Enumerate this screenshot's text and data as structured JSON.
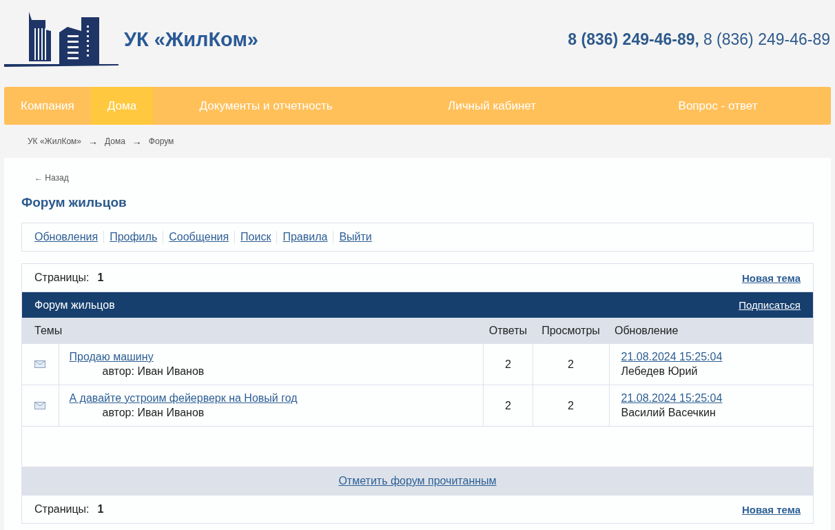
{
  "header": {
    "logo_text": "УК «ЖилКом»",
    "phone_primary": "8 (836) 249-46-89,",
    "phone_secondary": "8 (836) 249-46-89"
  },
  "nav": [
    {
      "label": "Компания",
      "selected": false
    },
    {
      "label": "Дома",
      "selected": true
    },
    {
      "label": "Документы и отчетность",
      "selected": false
    },
    {
      "label": "Личный кабинет",
      "selected": false
    },
    {
      "label": "Вопрос - ответ",
      "selected": false
    }
  ],
  "breadcrumbs": [
    {
      "kind": "link",
      "text": "УК «ЖилКом»"
    },
    {
      "kind": "arrow",
      "text": "→"
    },
    {
      "kind": "link",
      "text": "Дома"
    },
    {
      "kind": "arrow",
      "text": "→"
    },
    {
      "kind": "link",
      "text": "Форум"
    }
  ],
  "back_link": "← Назад",
  "page_title": "Форум жильцов",
  "forum_menu": [
    "Обновления",
    "Профиль",
    "Сообщения",
    "Поиск",
    "Правила",
    "Выйти"
  ],
  "pager_top": {
    "label": "Страницы:",
    "page": "1",
    "new_topic": "Новая тема"
  },
  "forum_bar": {
    "title": "Форум жильцов",
    "subscribe": "Подписаться"
  },
  "table": {
    "columns": [
      "Темы",
      "Ответы",
      "Просмотры",
      "Обновление"
    ],
    "rows": [
      {
        "title": "Продаю машину",
        "author": "автор: Иван Иванов",
        "replies": "2",
        "views": "2",
        "updated": "21.08.2024 15:25:04",
        "last_user": "Лебедев Юрий"
      },
      {
        "title": "А давайте устроим фейерверк на Новый год",
        "author": "автор: Иван Иванов",
        "replies": "2",
        "views": "2",
        "updated": "21.08.2024 15:25:04",
        "last_user": "Василий Васечкин"
      }
    ]
  },
  "mark_read": "Отметить форум прочитанным",
  "pager_bottom": {
    "label": "Страницы:",
    "page": "1",
    "new_topic": "Новая тема"
  }
}
